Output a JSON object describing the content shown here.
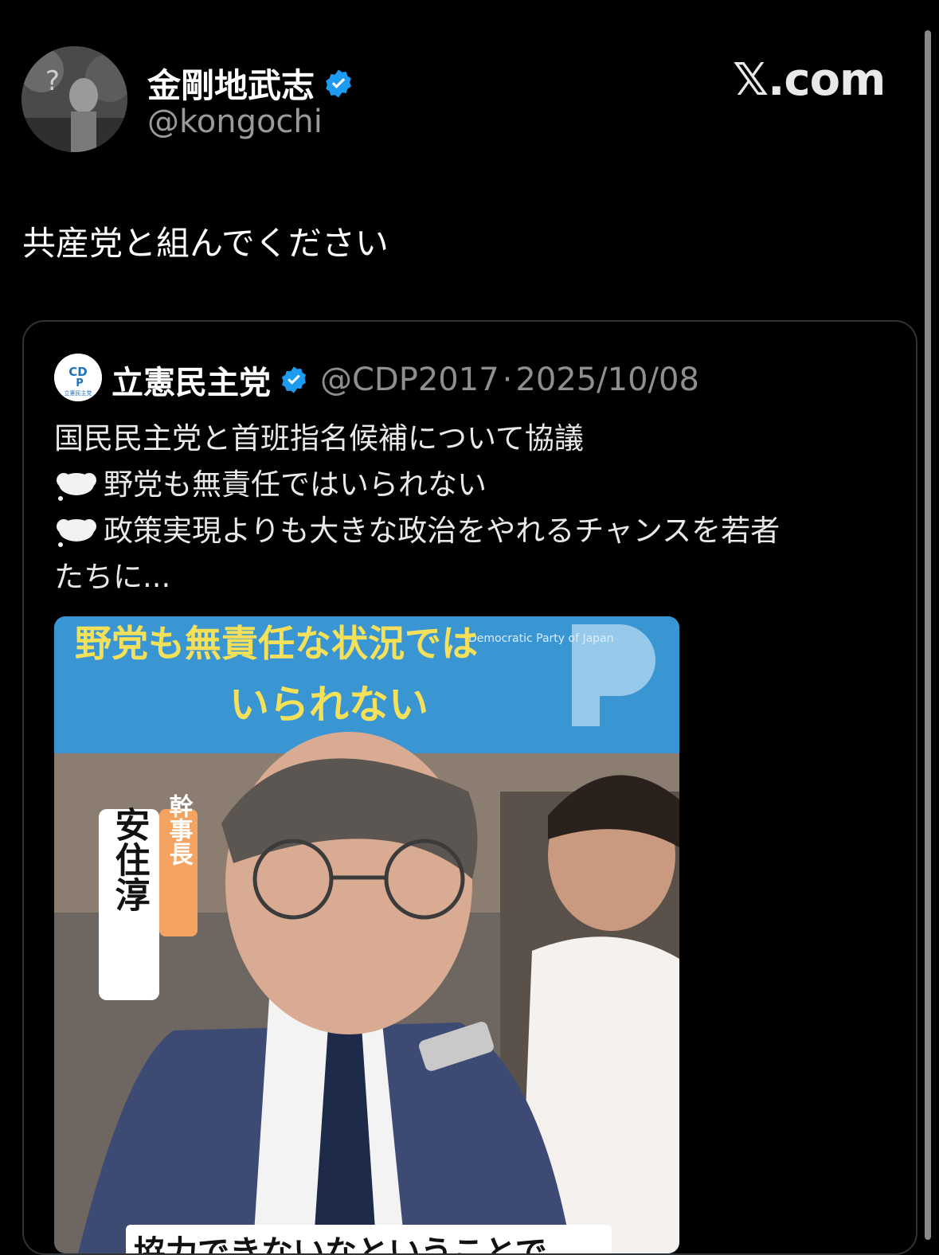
{
  "tweet": {
    "author_name": "金剛地武志",
    "author_handle": "@kongochi",
    "text": "共産党と組んでください",
    "verified_icon": "verified-badge-icon"
  },
  "brand": {
    "label": "𝕏.com"
  },
  "quoted": {
    "author_name": "立憲民主党",
    "author_handle": "@CDP2017",
    "separator": "·",
    "date": "2025/10/08",
    "lines": [
      "国民民主党と首班指名候補について協議",
      "野党も無責任ではいられない",
      "政策実現よりも大きな政治をやれるチャンスを若者",
      "たちに..."
    ],
    "avatar_text_top": "CD",
    "avatar_text_mid": "P",
    "avatar_text_bottom": "立憲民主党",
    "media": {
      "headline_1": "野党も無責任な状況では",
      "headline_2": "いられない",
      "title_tag": "幹事長",
      "person_name": "安住淳",
      "caption_partial": "協力できないなということで",
      "bg_text": "Democratic Party of Japan"
    }
  },
  "colors": {
    "background": "#000000",
    "accent_blue": "#1d9bf0",
    "border": "#2f3336"
  }
}
